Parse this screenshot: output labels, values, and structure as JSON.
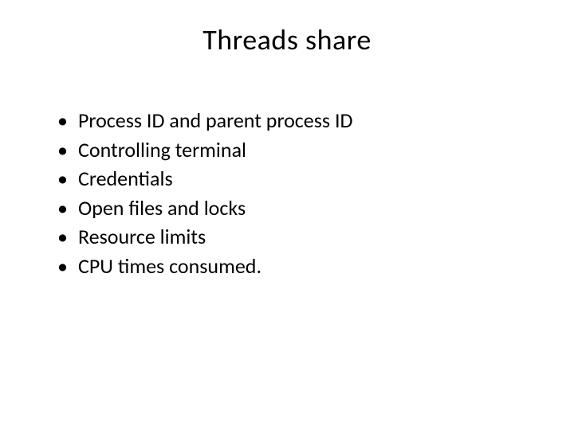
{
  "title": "Threads share",
  "bullets": [
    "Process ID and parent process ID",
    "Controlling terminal",
    "Credentials",
    "Open files and locks",
    "Resource limits",
    "CPU times consumed."
  ]
}
